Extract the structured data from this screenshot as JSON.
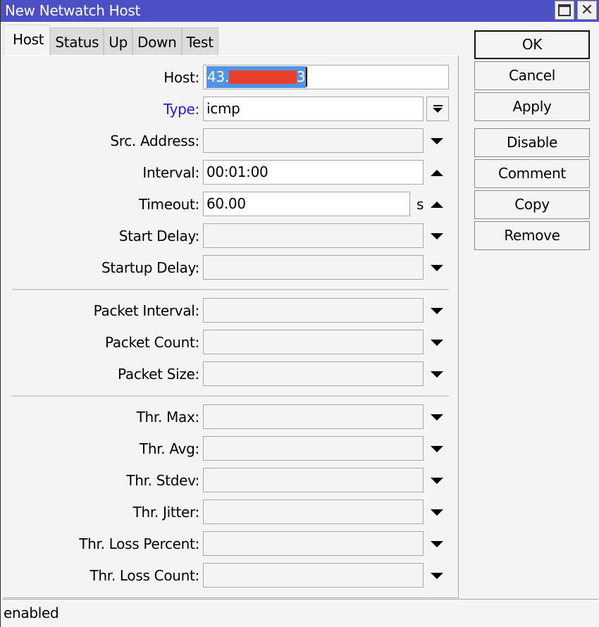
{
  "window": {
    "title": "New Netwatch Host",
    "maximize_icon": "maximize-icon",
    "close_icon": "close-icon"
  },
  "tabs": [
    {
      "label": "Host",
      "active": true
    },
    {
      "label": "Status",
      "active": false
    },
    {
      "label": "Up",
      "active": false
    },
    {
      "label": "Down",
      "active": false
    },
    {
      "label": "Test",
      "active": false
    }
  ],
  "form": {
    "host": {
      "label": "Host:",
      "value_prefix": "43.",
      "value_suffix": "3",
      "redacted": true
    },
    "type": {
      "label": "Type:",
      "value": "icmp",
      "label_color": "#1e1edc"
    },
    "src_address": {
      "label": "Src. Address:",
      "value": ""
    },
    "interval": {
      "label": "Interval:",
      "value": "00:01:00"
    },
    "timeout": {
      "label": "Timeout:",
      "value": "60.00",
      "unit": "s"
    },
    "start_delay": {
      "label": "Start Delay:",
      "value": ""
    },
    "startup_delay": {
      "label": "Startup Delay:",
      "value": ""
    },
    "packet_interval": {
      "label": "Packet Interval:",
      "value": ""
    },
    "packet_count": {
      "label": "Packet Count:",
      "value": ""
    },
    "packet_size": {
      "label": "Packet Size:",
      "value": ""
    },
    "thr_max": {
      "label": "Thr. Max:",
      "value": ""
    },
    "thr_avg": {
      "label": "Thr. Avg:",
      "value": ""
    },
    "thr_stdev": {
      "label": "Thr. Stdev:",
      "value": ""
    },
    "thr_jitter": {
      "label": "Thr. Jitter:",
      "value": ""
    },
    "thr_loss_percent": {
      "label": "Thr. Loss Percent:",
      "value": ""
    },
    "thr_loss_count": {
      "label": "Thr. Loss Count:",
      "value": ""
    }
  },
  "buttons": {
    "ok": "OK",
    "cancel": "Cancel",
    "apply": "Apply",
    "disable": "Disable",
    "comment": "Comment",
    "copy": "Copy",
    "remove": "Remove"
  },
  "status": {
    "text": "enabled"
  },
  "colors": {
    "titlebar": "#4c50c4",
    "selection": "#5294e2",
    "redaction": "#e8402a"
  }
}
